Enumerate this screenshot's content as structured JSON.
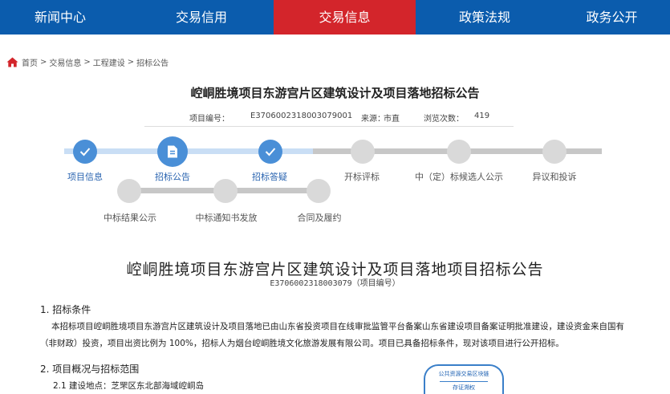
{
  "nav": {
    "items": [
      "新闻中心",
      "交易信用",
      "交易信息",
      "政策法规",
      "政务公开"
    ],
    "active": "交易信息",
    "bg_color": "#0b5cad",
    "active_color": "#d3252b"
  },
  "breadcrumb": {
    "icon": "home-icon",
    "home": "首页",
    "sep": ">",
    "items": [
      "交易信息",
      "工程建设",
      "招标公告"
    ]
  },
  "page_title": "崆峒胜境项目东游宫片区建筑设计及项目落地招标公告",
  "meta": {
    "code_label": "项目编号：",
    "code_value": "E3706002318003079001",
    "source_label": "来源：",
    "source_value": "市直",
    "views_label": "浏览次数：",
    "views_value": "419"
  },
  "steps": {
    "row1": [
      "项目信息",
      "招标公告",
      "招标答疑",
      "开标评标",
      "中（定）标候选人公示",
      "异议和投诉"
    ],
    "row2": [
      "中标结果公示",
      "中标通知书发放",
      "合同及履约"
    ],
    "completed_count": 3,
    "current": "招标公告",
    "done_color": "#4a8fd7"
  },
  "document": {
    "title": "崆峒胜境项目东游宫片区建筑设计及项目落地项目招标公告",
    "subtitle": "E3706002318003079（项目编号）",
    "section1_title": "1. 招标条件",
    "section1_body": "本招标项目崆峒胜境项目东游宫片区建筑设计及项目落地已由山东省投资项目在线审批监管平台备案山东省建设项目备案证明批准建设，建设资金来自国有（非财政）投资，项目出资比例为 100%，招标人为烟台崆峒胜境文化旅游发展有限公司。项目已具备招标条件，现对该项目进行公开招标。",
    "section2_title": "2. 项目概况与招标范围",
    "item_2_1": "2.1  建设地点：芝罘区东北部海域崆峒岛"
  },
  "stamp": {
    "line1": "公共资源交易区块链",
    "line2": "存证溯权",
    "color": "#3a7fc9"
  }
}
